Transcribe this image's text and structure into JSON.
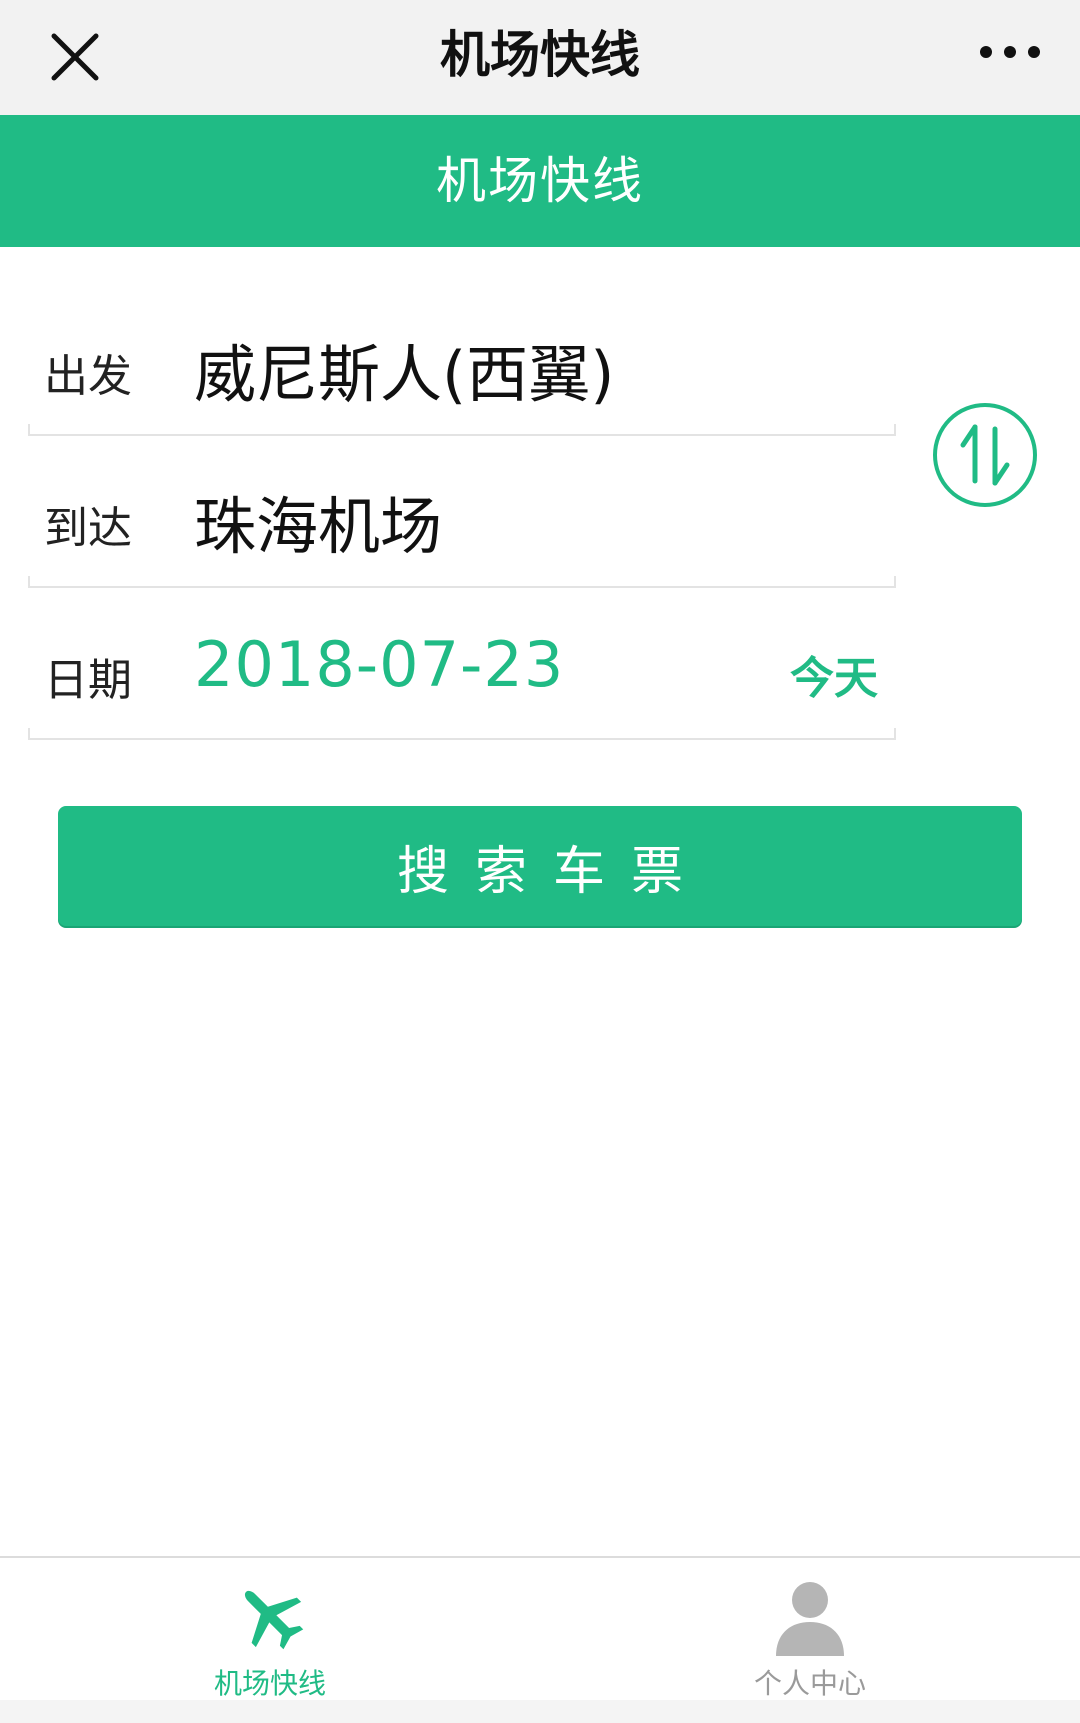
{
  "nav": {
    "title": "机场快线",
    "close_icon": "close-icon",
    "more_icon": "more-icon"
  },
  "header": {
    "title": "机场快线"
  },
  "form": {
    "from": {
      "label": "出发",
      "value": "威尼斯人(西翼)"
    },
    "to": {
      "label": "到达",
      "value": "珠海机场"
    },
    "date": {
      "label": "日期",
      "value": "2018-07-23",
      "today_label": "今天"
    },
    "swap_icon": "swap-icon"
  },
  "search": {
    "label": "搜索车票"
  },
  "tabs": [
    {
      "label": "机场快线",
      "icon": "airplane-icon",
      "active": true
    },
    {
      "label": "个人中心",
      "icon": "user-icon",
      "active": false
    }
  ],
  "colors": {
    "accent": "#20bb85",
    "nav_bg": "#f2f2f2",
    "inactive": "#9a9a9a"
  }
}
